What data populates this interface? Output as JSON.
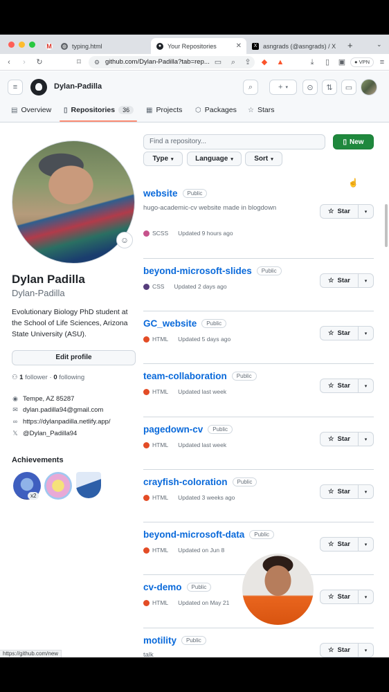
{
  "browser": {
    "tabs": [
      {
        "label": "typing.html",
        "active": false
      },
      {
        "label": "Your Repositories",
        "active": true
      },
      {
        "label": "asngrads (@asngrads) / X",
        "active": false
      }
    ],
    "url": "github.com/Dylan-Padilla?tab=rep...",
    "vpn_label": "VPN",
    "status_url": "https://github.com/new"
  },
  "header": {
    "owner": "Dylan-Padilla"
  },
  "profile_nav": [
    {
      "label": "Overview",
      "icon": "book-open-icon"
    },
    {
      "label": "Repositories",
      "icon": "repo-icon",
      "count": "36",
      "active": true
    },
    {
      "label": "Projects",
      "icon": "table-icon"
    },
    {
      "label": "Packages",
      "icon": "package-icon"
    },
    {
      "label": "Stars",
      "icon": "star-icon"
    }
  ],
  "profile": {
    "name": "Dylan Padilla",
    "login": "Dylan-Padilla",
    "bio": "Evolutionary Biology PhD student at the School of Life Sciences, Arizona State University (ASU).",
    "edit_label": "Edit profile",
    "followers_count": "1",
    "followers_label": "follower",
    "following_count": "0",
    "following_label": "following",
    "location": "Tempe, AZ 85287",
    "email": "dylan.padilla94@gmail.com",
    "website": "https://dylanpadilla.netlify.app/",
    "twitter": "@Dylan_Padilla94",
    "achievements_title": "Achievements",
    "achievement_multiplier": "x2"
  },
  "repo_controls": {
    "find_placeholder": "Find a repository...",
    "new_label": "New",
    "type_label": "Type",
    "language_label": "Language",
    "sort_label": "Sort"
  },
  "repos": [
    {
      "name": "website",
      "visibility": "Public",
      "description": "hugo-academic-cv website made in blogdown",
      "language": "SCSS",
      "lang_color": "#c6538c",
      "updated": "Updated 9 hours ago"
    },
    {
      "name": "beyond-microsoft-slides",
      "visibility": "Public",
      "description": "",
      "language": "CSS",
      "lang_color": "#563d7c",
      "updated": "Updated 2 days ago"
    },
    {
      "name": "GC_website",
      "visibility": "Public",
      "description": "",
      "language": "HTML",
      "lang_color": "#e34c26",
      "updated": "Updated 5 days ago"
    },
    {
      "name": "team-collaboration",
      "visibility": "Public",
      "description": "",
      "language": "HTML",
      "lang_color": "#e34c26",
      "updated": "Updated last week"
    },
    {
      "name": "pagedown-cv",
      "visibility": "Public",
      "description": "",
      "language": "HTML",
      "lang_color": "#e34c26",
      "updated": "Updated last week"
    },
    {
      "name": "crayfish-coloration",
      "visibility": "Public",
      "description": "",
      "language": "HTML",
      "lang_color": "#e34c26",
      "updated": "Updated 3 weeks ago"
    },
    {
      "name": "beyond-microsoft-data",
      "visibility": "Public",
      "description": "",
      "language": "HTML",
      "lang_color": "#e34c26",
      "updated": "Updated on Jun 8"
    },
    {
      "name": "cv-demo",
      "visibility": "Public",
      "description": "",
      "language": "HTML",
      "lang_color": "#e34c26",
      "updated": "Updated on May 21"
    },
    {
      "name": "motility",
      "visibility": "Public",
      "description": "talk",
      "language": "",
      "lang_color": "#e34c26",
      "updated": ""
    }
  ],
  "star_label": "Star"
}
